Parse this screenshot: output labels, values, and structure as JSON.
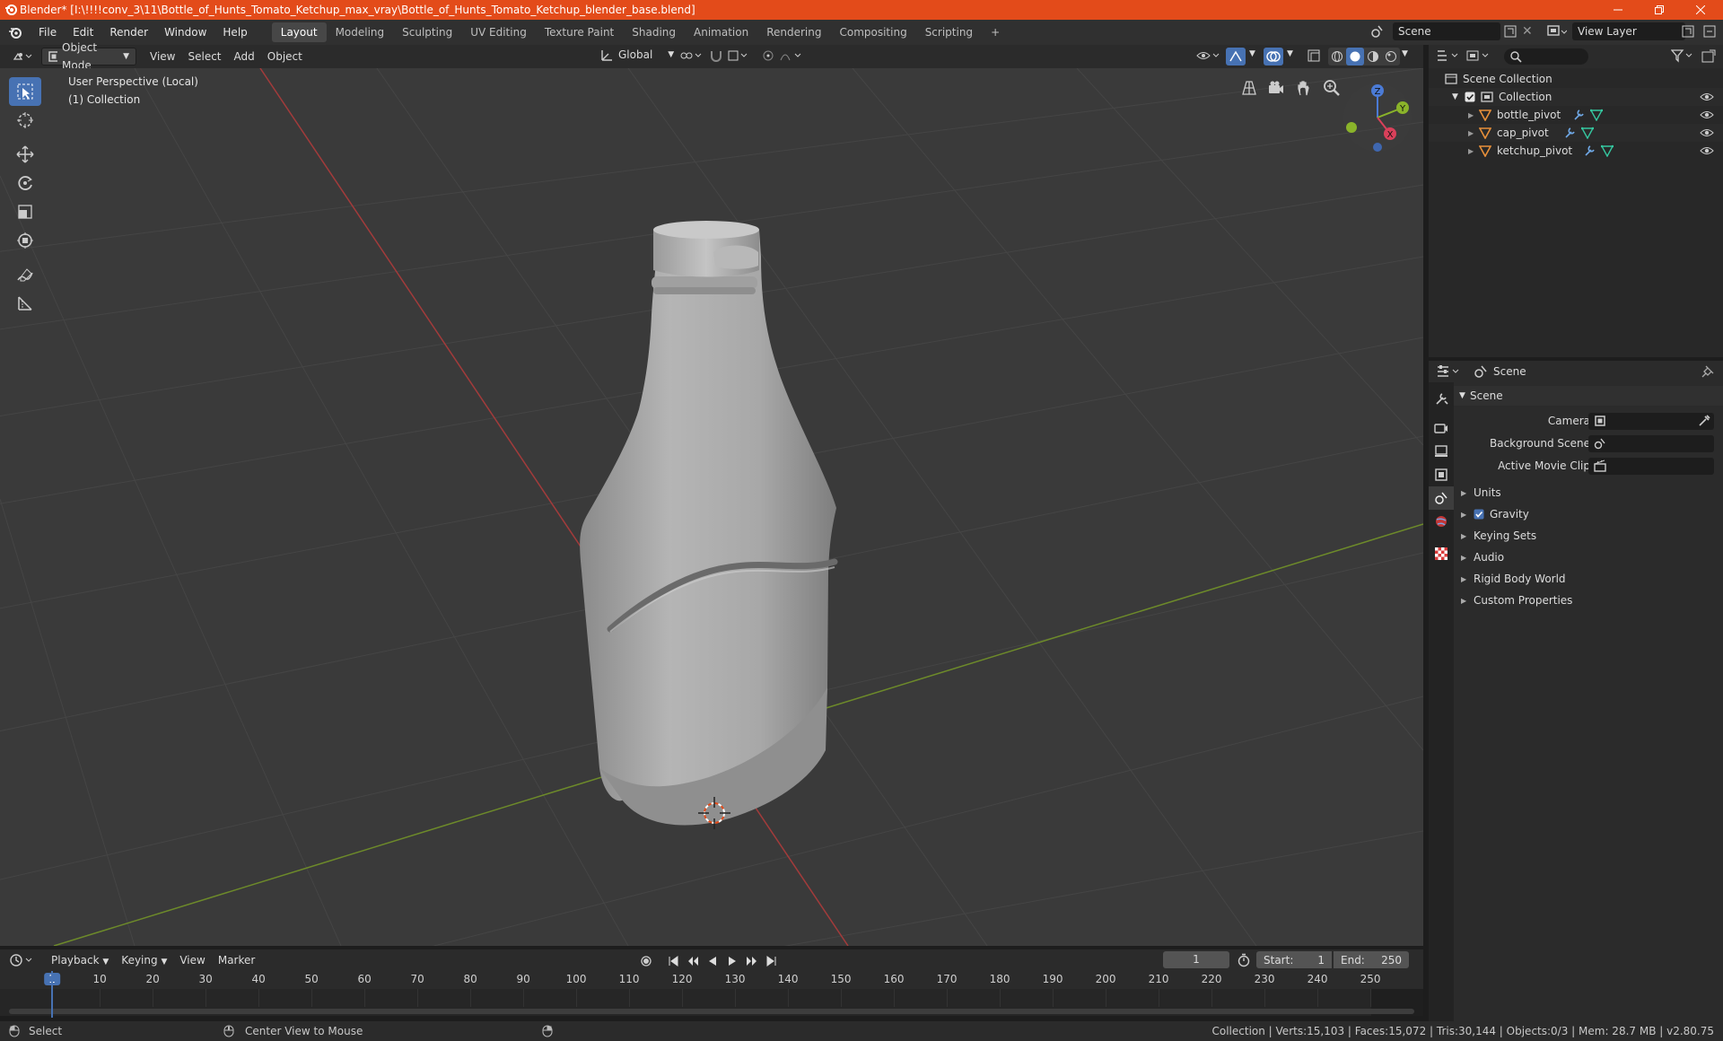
{
  "window": {
    "title": "Blender* [I:\\!!!!conv_3\\11\\Bottle_of_Hunts_Tomato_Ketchup_max_vray\\Bottle_of_Hunts_Tomato_Ketchup_blender_base.blend]",
    "accent": "#e34b1a"
  },
  "menubar": {
    "items": [
      "File",
      "Edit",
      "Render",
      "Window",
      "Help"
    ],
    "workspaces": [
      "Layout",
      "Modeling",
      "Sculpting",
      "UV Editing",
      "Texture Paint",
      "Shading",
      "Animation",
      "Rendering",
      "Compositing",
      "Scripting"
    ],
    "active_workspace": "Layout",
    "scene": "Scene",
    "view_layer": "View Layer"
  },
  "viewport_header": {
    "mode": "Object Mode",
    "menus": [
      "View",
      "Select",
      "Add",
      "Object"
    ],
    "orientation": "Global"
  },
  "viewport": {
    "perspective": "User Perspective (Local)",
    "collection": "(1) Collection",
    "gizmo": {
      "z": "Z",
      "y": "Y",
      "x": "X"
    }
  },
  "outliner": {
    "root": "Scene Collection",
    "collection": "Collection",
    "objects": [
      "bottle_pivot",
      "cap_pivot",
      "ketchup_pivot"
    ]
  },
  "properties": {
    "context": "Scene",
    "panel": "Scene",
    "fields": [
      {
        "label": "Camera"
      },
      {
        "label": "Background Scene"
      },
      {
        "label": "Active Movie Clip"
      }
    ],
    "subpanels": [
      "Units",
      "Gravity",
      "Keying Sets",
      "Audio",
      "Rigid Body World",
      "Custom Properties"
    ],
    "gravity_checked": true
  },
  "timeline": {
    "menus": [
      "Playback",
      "Keying",
      "View",
      "Marker"
    ],
    "current_frame": "1",
    "start_label": "Start:",
    "start": "1",
    "end_label": "End:",
    "end": "250",
    "ruler_ticks": [
      "1",
      "10",
      "20",
      "30",
      "40",
      "50",
      "60",
      "70",
      "80",
      "90",
      "100",
      "110",
      "120",
      "130",
      "140",
      "150",
      "160",
      "170",
      "180",
      "190",
      "200",
      "210",
      "220",
      "230",
      "240",
      "250"
    ],
    "playhead_accent": "#4772b3"
  },
  "statusbar": {
    "left_action": "Select",
    "middle_action": "Center View to Mouse",
    "stats": "Collection | Verts:15,103 | Faces:15,072 | Tris:30,144 | Objects:0/3 | Mem: 28.7 MB | v2.80.75"
  }
}
